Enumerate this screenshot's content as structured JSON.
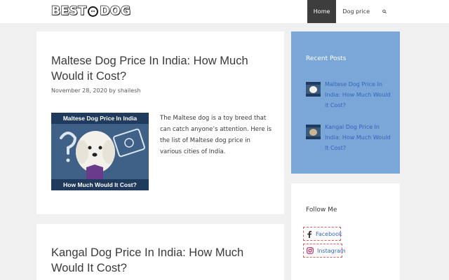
{
  "header": {
    "logo_left": "BEST",
    "logo_right": "DOG",
    "nav": [
      {
        "label": "Home",
        "active": true
      },
      {
        "label": "Dog price",
        "active": false
      }
    ],
    "search_icon": "search-icon"
  },
  "posts": [
    {
      "title": "Maltese Dog Price In India: How Much Would it Cost?",
      "meta": "November 28, 2020 by shailesh",
      "thumb_top": "Maltese Dog Price In India",
      "thumb_bottom": "How Much Would It Cost?",
      "excerpt": "The Maltese dog is a toy breed that can catch anyone’s attention. Here is the list of Maltese dog price in various cities of India."
    },
    {
      "title": "Kangal Dog Price In India: How Much Would It Cost?"
    }
  ],
  "sidebar": {
    "recent_title": "Recent Posts",
    "recent_items": [
      {
        "label": "Maltese Dog Price In India: How Much Would it Cost?"
      },
      {
        "label": "Kangal Dog Price In India: How Much Would It Cost?"
      }
    ],
    "follow_title": "Follow Me",
    "social": [
      {
        "label": "Facebook",
        "icon": "facebook-icon"
      },
      {
        "label": "Instagram",
        "icon": "instagram-icon"
      }
    ]
  },
  "colors": {
    "nav_active_bg": "#3d3d3d",
    "sidebar_accent": "#7aa6d8",
    "link": "#3366bb"
  }
}
